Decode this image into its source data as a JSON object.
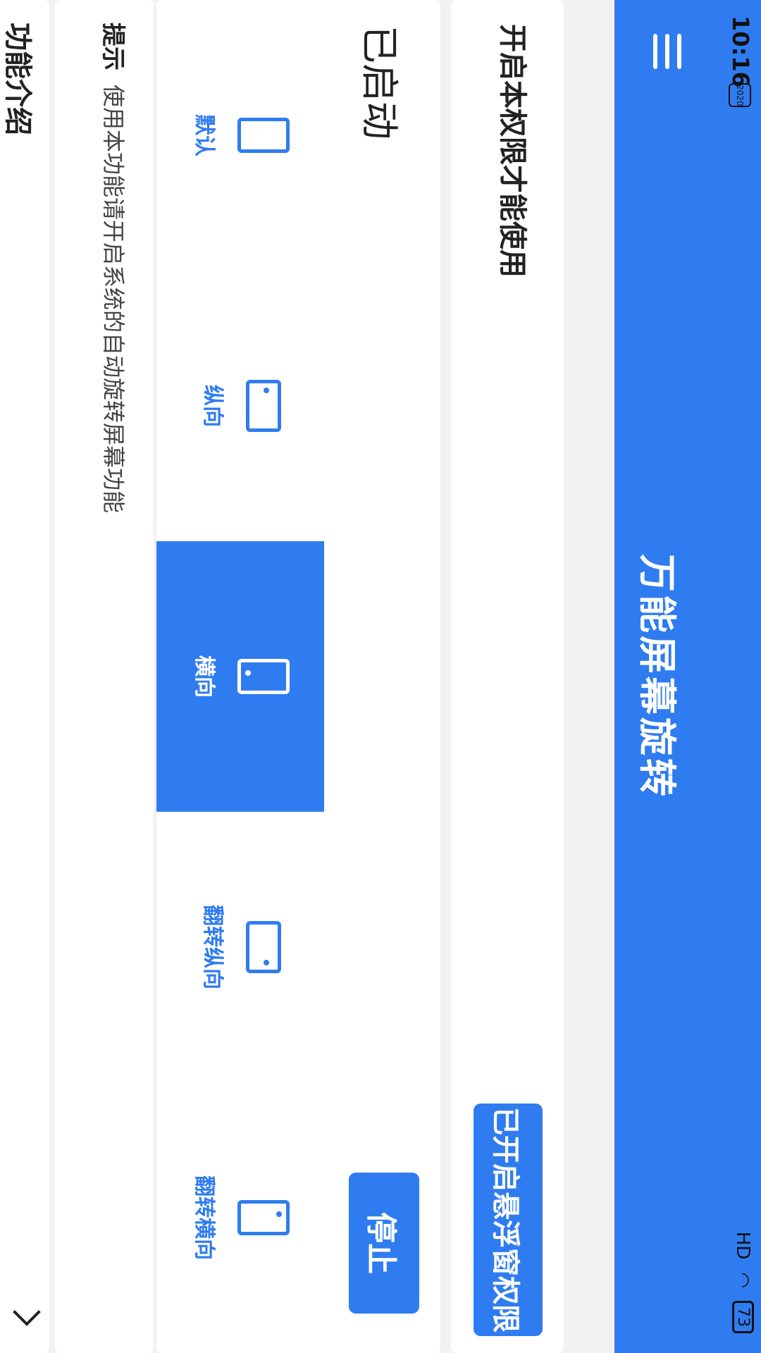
{
  "status_bar": {
    "time": "10:16",
    "time_badge": "2020",
    "signal": "HD",
    "battery": "73"
  },
  "toolbar": {
    "title": "万能屏幕旋转"
  },
  "permission": {
    "text": "开启本权限才能使用",
    "button_label": "已开启悬浮窗权限"
  },
  "service": {
    "status_text": "已启动",
    "stop_label": "停止"
  },
  "orientations": [
    {
      "label": "默认",
      "icon": "phone-outline-icon",
      "selected": false
    },
    {
      "label": "纵向",
      "icon": "phone-portrait-icon",
      "selected": false
    },
    {
      "label": "横向",
      "icon": "phone-landscape-icon",
      "selected": true
    },
    {
      "label": "翻转纵向",
      "icon": "phone-portrait-flipped-icon",
      "selected": false
    },
    {
      "label": "翻转横向",
      "icon": "phone-landscape-flipped-icon",
      "selected": false
    }
  ],
  "hint": {
    "title": "提示",
    "text": "使用本功能请开启系统的自动旋转屏幕功能"
  },
  "intro": {
    "label": "功能介绍"
  },
  "colors": {
    "accent": "#2f7cf0",
    "background": "#f2f2f2"
  }
}
